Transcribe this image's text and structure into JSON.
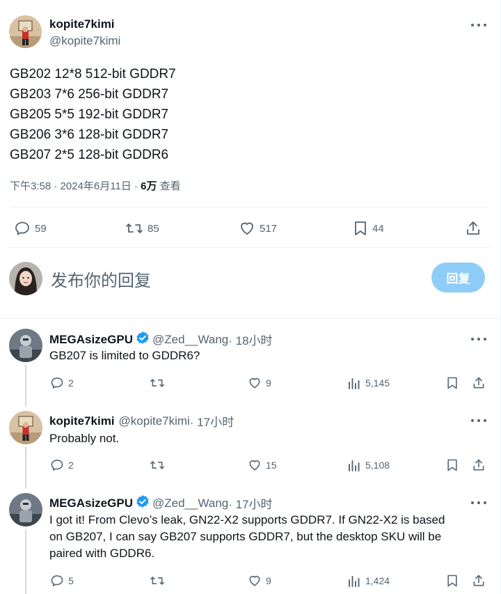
{
  "main_tweet": {
    "author_name": "kopite7kimi",
    "author_handle": "@kopite7kimi",
    "lines": [
      "GB202 12*8 512-bit GDDR7",
      "GB203 7*6 256-bit GDDR7",
      "GB205 5*5 192-bit GDDR7",
      "GB206 3*6 128-bit GDDR7",
      "GB207 2*5 128-bit GDDR6"
    ],
    "time": "下午3:58 · 2024年6月11日 · ",
    "views_count": "6万",
    "views_label": " 查看",
    "actions": {
      "replies": "59",
      "retweets": "85",
      "likes": "517",
      "bookmarks": "44"
    }
  },
  "composer": {
    "placeholder": "发布你的回复",
    "reply_button": "回复"
  },
  "replies": [
    {
      "author_name": "MEGAsizeGPU",
      "author_handle": "@Zed__Wang",
      "time": " · 18小时",
      "verified": true,
      "text": "GB207 is limited to GDDR6?",
      "replies": "2",
      "retweets": "",
      "likes": "9",
      "views": "5,145"
    },
    {
      "author_name": "kopite7kimi",
      "author_handle": "@kopite7kimi",
      "time": " · 17小时",
      "verified": false,
      "text": "Probably not.",
      "replies": "2",
      "retweets": "",
      "likes": "15",
      "views": "5,108"
    },
    {
      "author_name": "MEGAsizeGPU",
      "author_handle": "@Zed__Wang",
      "time": " · 17小时",
      "verified": true,
      "text_lines": [
        "I got it! From Clevo’s leak, GN22-X2 supports GDDR7. If GN22-X2 is based",
        "on GB207, I can say GB207 supports GDDR7, but the desktop SKU will be",
        "paired with GDDR6."
      ],
      "replies": "5",
      "retweets": "",
      "likes": "9",
      "views": "1,424"
    }
  ],
  "colors": {
    "text": "#0f1419",
    "secondary": "#536471",
    "divider": "#eff3f4",
    "verified": "#1d9bf0",
    "reply_button_disabled": "#8ecdf8"
  },
  "icons": [
    "more-icon",
    "reply-icon",
    "retweet-icon",
    "like-icon",
    "bookmark-icon",
    "share-icon",
    "views-icon",
    "verified-badge-icon"
  ]
}
